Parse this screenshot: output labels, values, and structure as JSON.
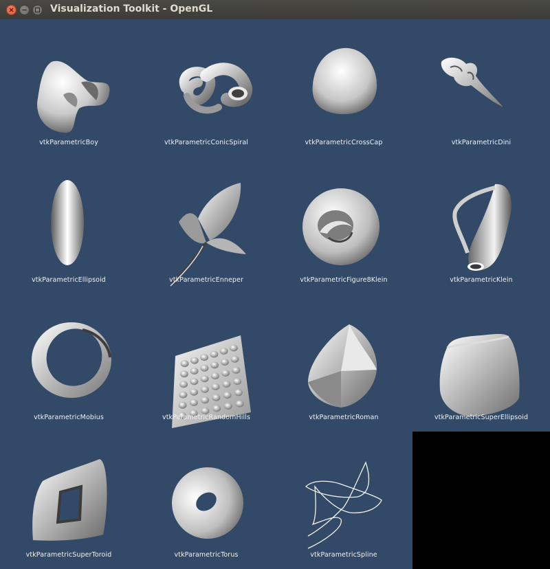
{
  "window": {
    "title": "Visualization Toolkit - OpenGL",
    "controls": [
      "close-icon",
      "minimize-icon",
      "maximize-icon"
    ]
  },
  "viewports": [
    {
      "label": "vtkParametricBoy"
    },
    {
      "label": "vtkParametricConicSpiral"
    },
    {
      "label": "vtkParametricCrossCap"
    },
    {
      "label": "vtkParametricDini"
    },
    {
      "label": "vtkParametricEllipsoid"
    },
    {
      "label": "vtkParametricEnneper"
    },
    {
      "label": "vtkParametricFigure8Klein"
    },
    {
      "label": "vtkParametricKlein"
    },
    {
      "label": "vtkParametricMobius"
    },
    {
      "label": "vtkParametricRandomHills"
    },
    {
      "label": "vtkParametricRoman"
    },
    {
      "label": "vtkParametricSuperEllipsoid"
    },
    {
      "label": "vtkParametricSuperToroid"
    },
    {
      "label": "vtkParametricTorus"
    },
    {
      "label": "vtkParametricSpline"
    }
  ],
  "colors": {
    "viewport_background": "#324a67",
    "empty_viewport": "#000000",
    "label_text": "#f2f2f2",
    "titlebar": "#3c3b37"
  }
}
